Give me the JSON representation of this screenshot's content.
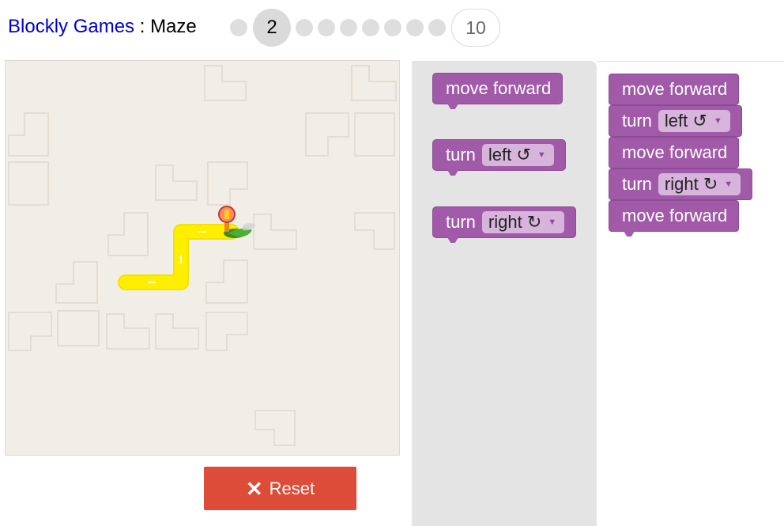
{
  "header": {
    "site_link": "Blockly Games",
    "separator": " : ",
    "game_name": "Maze",
    "levels": [
      "1",
      "2",
      "3",
      "4",
      "5",
      "6",
      "7",
      "8",
      "9",
      "10"
    ],
    "current_level": "2",
    "last_level": "10"
  },
  "reset": {
    "icon": "close-icon",
    "label": "Reset"
  },
  "toolbox": {
    "blocks": [
      {
        "verb": "move forward",
        "dropdown": ""
      },
      {
        "verb": "turn",
        "dropdown": "left ↺"
      },
      {
        "verb": "turn",
        "dropdown": "right ↻"
      }
    ]
  },
  "workspace": {
    "blocks": [
      {
        "verb": "move forward",
        "dropdown": ""
      },
      {
        "verb": "turn",
        "dropdown": "left ↺"
      },
      {
        "verb": "move forward",
        "dropdown": ""
      },
      {
        "verb": "turn",
        "dropdown": "right ↻"
      },
      {
        "verb": "move forward",
        "dropdown": ""
      }
    ]
  },
  "colors": {
    "block": "#a05aa8",
    "field": "#d7b4dc",
    "path": "#ffee00",
    "reset": "#dd4b39",
    "link": "#0000cc"
  },
  "maze": {
    "avatar": "pegman-icon",
    "goal": "goal-marker-icon"
  }
}
